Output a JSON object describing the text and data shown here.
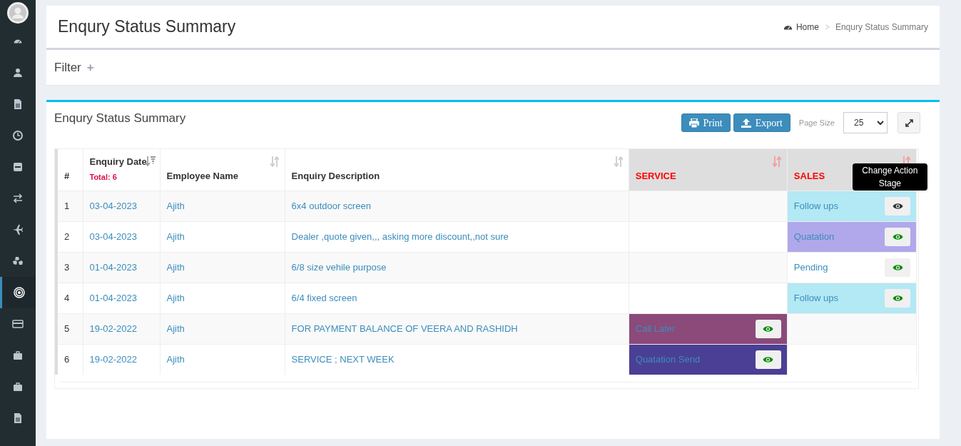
{
  "sidebar": {
    "items": [
      {
        "selected": false
      },
      {
        "selected": false
      },
      {
        "selected": false
      },
      {
        "selected": false
      },
      {
        "selected": false
      },
      {
        "selected": false
      },
      {
        "selected": false
      },
      {
        "selected": false
      },
      {
        "selected": true
      },
      {
        "selected": false
      },
      {
        "selected": false
      },
      {
        "selected": false
      },
      {
        "selected": false
      }
    ]
  },
  "header": {
    "title": "Enqury Status Summary",
    "breadcrumb": [
      "Home",
      "Enqury Status Summary"
    ],
    "separator": ">"
  },
  "filter": {
    "title": "Filter",
    "toggle": "+"
  },
  "panel": {
    "title": "Enqury Status Summary",
    "buttons": [
      {
        "kind": "print",
        "label": "Print"
      },
      {
        "kind": "export",
        "label": "Export"
      }
    ],
    "page_size_label": "Page Size",
    "page_size": "25"
  },
  "table": {
    "columns": [
      {
        "label": "#",
        "kind": "plain"
      },
      {
        "label": "Enquiry Date",
        "sub": "Total: 6",
        "kind": "sorted"
      },
      {
        "label": "Employee Name",
        "kind": "sortable"
      },
      {
        "label": "Enquiry Description",
        "kind": "sortable"
      },
      {
        "label": "SERVICE",
        "kind": "stage"
      },
      {
        "label": "SALES",
        "kind": "stage"
      }
    ],
    "rows": [
      {
        "no": "1",
        "date": "03-04-2023",
        "employee": "Ajith",
        "description": "6x4 outdoor screen",
        "service": null,
        "sales": {
          "status": "Follow ups",
          "color": "#b3e8f5",
          "tooltip": "Change Action Stage"
        }
      },
      {
        "no": "2",
        "date": "03-04-2023",
        "employee": "Ajith",
        "description": "Dealer ,quote given,,, asking more discount,,not sure",
        "service": null,
        "sales": {
          "status": "Quatation",
          "color": "#b0a8eb"
        }
      },
      {
        "no": "3",
        "date": "01-04-2023",
        "employee": "Ajith",
        "description": "6/8 size vehile purpose",
        "service": null,
        "sales": {
          "status": "Pending",
          "color": "#ffffff"
        }
      },
      {
        "no": "4",
        "date": "01-04-2023",
        "employee": "Ajith",
        "description": "6/4 fixed screen",
        "service": null,
        "sales": {
          "status": "Follow ups",
          "color": "#b3e8f5"
        }
      },
      {
        "no": "5",
        "date": "19-02-2022",
        "employee": "Ajith",
        "description": "FOR PAYMENT BALANCE OF VEERA AND RASHIDH",
        "service": {
          "status": "Call Later",
          "color": "#8b4a7a"
        },
        "sales": null
      },
      {
        "no": "6",
        "date": "19-02-2022",
        "employee": "Ajith",
        "description": "SERVICE ; NEXT WEEK",
        "service": {
          "status": "Quatation Send",
          "color": "#4a3f94"
        },
        "sales": null
      }
    ]
  }
}
